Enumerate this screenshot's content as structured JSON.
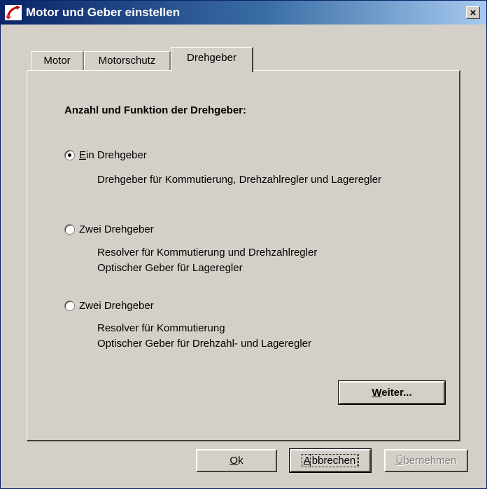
{
  "window": {
    "title": "Motor und Geber einstellen",
    "close_symbol": "×"
  },
  "tabs": [
    {
      "label": "Motor",
      "active": false
    },
    {
      "label": "Motorschutz",
      "active": false
    },
    {
      "label": "Drehgeber",
      "active": true
    }
  ],
  "panel": {
    "heading": "Anzahl und Funktion der Drehgeber:",
    "options": [
      {
        "label_mnemonic": "E",
        "label_rest": "in Drehgeber",
        "checked": true,
        "lines": [
          "Drehgeber für Kommutierung, Drehzahlregler und Lageregler"
        ]
      },
      {
        "label": "Zwei Drehgeber",
        "checked": false,
        "lines": [
          "Resolver für Kommutierung und Drehzahlregler",
          "Optischer Geber für Lageregler"
        ]
      },
      {
        "label": "Zwei Drehgeber",
        "checked": false,
        "lines": [
          "Resolver für Kommutierung",
          "Optischer Geber für Drehzahl- und Lageregler"
        ]
      }
    ],
    "next_button": {
      "mnemonic": "W",
      "rest": "eiter..."
    }
  },
  "buttons": {
    "ok": {
      "mnemonic": "O",
      "rest": "k"
    },
    "cancel": {
      "mnemonic": "A",
      "rest": "bbrechen"
    },
    "apply": {
      "mnemonic": "Ü",
      "rest": "bernehmen"
    }
  },
  "colors": {
    "title_start": "#0a246a",
    "title_end": "#a6caf0",
    "face": "#d4d0c8"
  }
}
